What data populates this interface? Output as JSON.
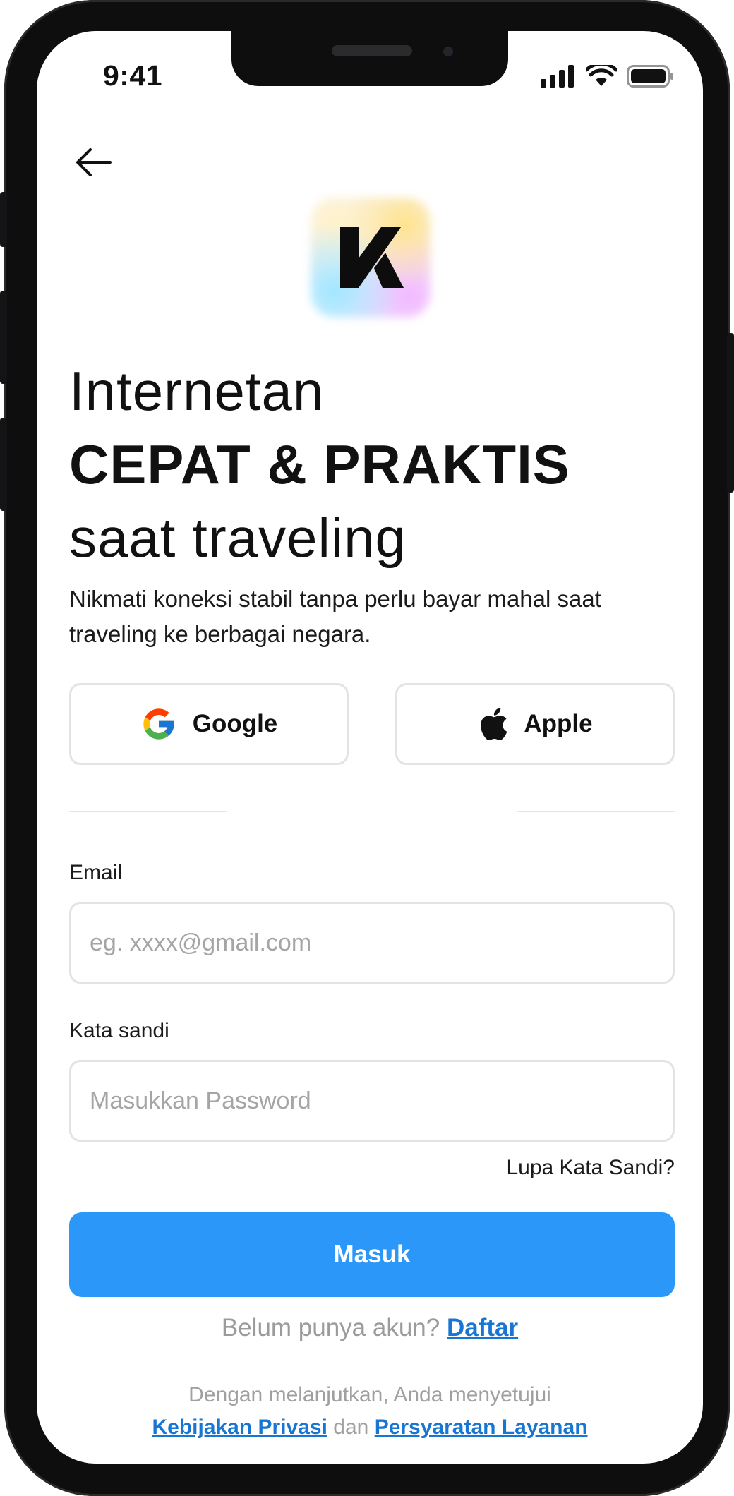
{
  "status_bar": {
    "time": "9:41"
  },
  "brand": {
    "logo_letter": "K"
  },
  "headline": {
    "line1": "Internetan",
    "line2": "CEPAT & PRAKTIS",
    "line3": "saat traveling"
  },
  "subtitle": "Nikmati koneksi stabil tanpa perlu bayar mahal saat traveling ke berbagai negara.",
  "social": {
    "google_label": "Google",
    "apple_label": "Apple"
  },
  "form": {
    "email_label": "Email",
    "email_placeholder": "eg. xxxx@gmail.com",
    "password_label": "Kata sandi",
    "password_placeholder": "Masukkan Password",
    "forgot_label": "Lupa Kata Sandi?",
    "submit_label": "Masuk"
  },
  "signup": {
    "prompt": "Belum punya akun?",
    "link": "Daftar"
  },
  "legal": {
    "prefix": "Dengan melanjutkan, Anda menyetujui",
    "privacy": "Kebijakan Privasi",
    "and": "dan",
    "terms": "Persyaratan Layanan"
  },
  "colors": {
    "primary": "#2a97f9",
    "link": "#1876d2",
    "text": "#111111",
    "muted": "#9b9b9b"
  }
}
